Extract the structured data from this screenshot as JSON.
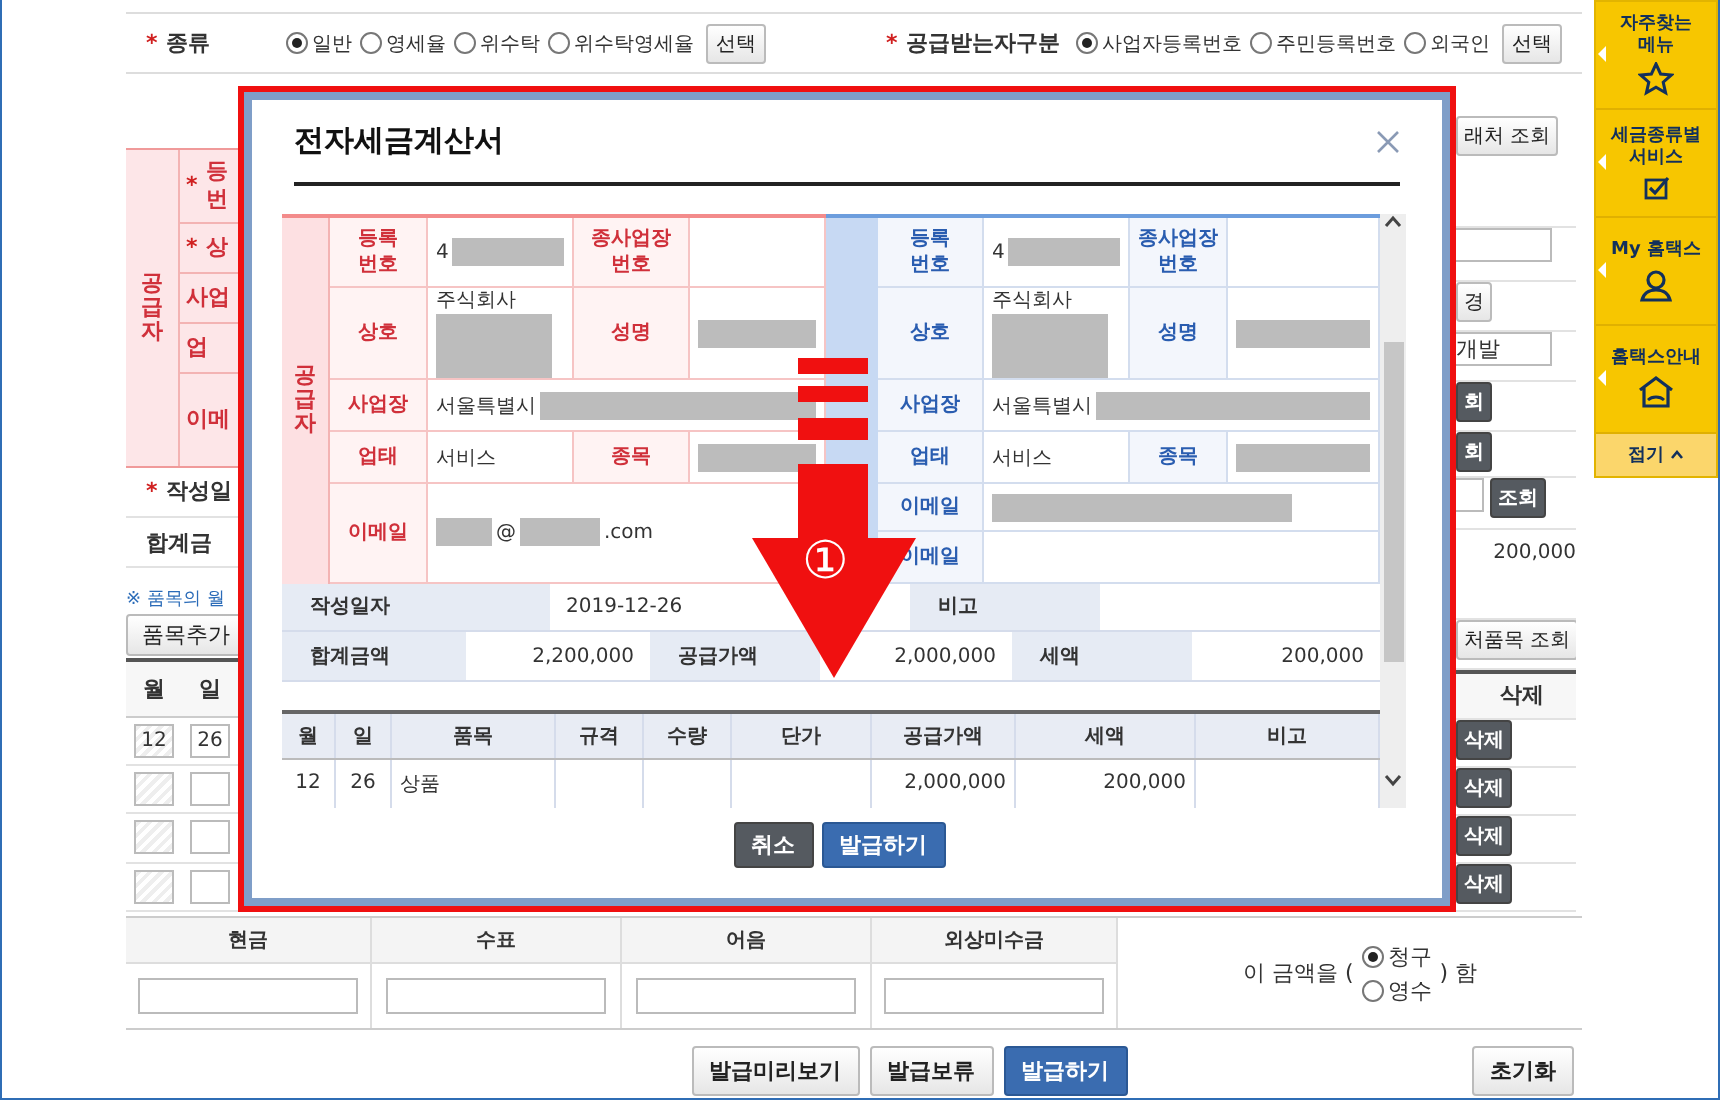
{
  "type_row": [
    {
      "required_mark": "*",
      "label": "종류",
      "options": [
        {
          "label": "일반",
          "selected": true
        },
        {
          "label": "영세율",
          "selected": false
        },
        {
          "label": "위수탁",
          "selected": false
        },
        {
          "label": "위수탁영세율",
          "selected": false
        }
      ],
      "button": "선택"
    },
    {
      "required_mark": "*",
      "label": "공급받는자구분",
      "options": [
        {
          "label": "사업자등록번호",
          "selected": true
        },
        {
          "label": "주민등록번호",
          "selected": false
        },
        {
          "label": "외국인",
          "selected": false
        }
      ],
      "button": "선택"
    }
  ],
  "left_strip": {
    "supplier_label": "공급자",
    "labels": [
      {
        "required_mark": "*",
        "lines": [
          "등",
          "번"
        ]
      },
      {
        "required_mark": "*",
        "lines": [
          "상"
        ]
      },
      {
        "lines": [
          "사업"
        ]
      },
      {
        "lines": [
          "업"
        ]
      },
      {
        "lines": [
          "이메"
        ]
      }
    ],
    "date_label": {
      "required_mark": "*",
      "text": "작성일"
    },
    "total_label": "합계금",
    "note": "※ 품목의 월",
    "add_button": "품목추가",
    "item_headers": [
      "월",
      "일"
    ],
    "item_rows": [
      {
        "kind": "filled",
        "month": "12",
        "day": "26"
      },
      {
        "kind": "empty"
      },
      {
        "kind": "empty"
      },
      {
        "kind": "empty"
      }
    ]
  },
  "dialog": {
    "title": "전자세금계산서",
    "supplier": {
      "group_label": "공급자",
      "rows": [
        {
          "cells": [
            {
              "kind": "label",
              "lines": [
                "등록",
                "번호"
              ]
            },
            {
              "kind": "value",
              "parts": [
                {
                  "kind": "text",
                  "text": "4"
                },
                {
                  "kind": "redacted"
                }
              ]
            },
            {
              "kind": "label",
              "lines": [
                "종사업장",
                "번호"
              ]
            },
            {
              "kind": "value"
            }
          ]
        },
        {
          "cells": [
            {
              "kind": "label",
              "lines": [
                "상호"
              ]
            },
            {
              "kind": "value",
              "parts": [
                {
                  "kind": "text",
                  "text": "주식회사"
                },
                {
                  "kind": "redacted_block"
                }
              ]
            },
            {
              "kind": "label",
              "lines": [
                "성명"
              ]
            },
            {
              "kind": "value",
              "parts": [
                {
                  "kind": "redacted"
                }
              ]
            }
          ]
        },
        {
          "cells": [
            {
              "kind": "label",
              "lines": [
                "사업장"
              ]
            },
            {
              "kind": "wide_value",
              "parts": [
                {
                  "kind": "text",
                  "text": "서울특별시"
                },
                {
                  "kind": "redacted"
                }
              ]
            }
          ]
        },
        {
          "cells": [
            {
              "kind": "label",
              "lines": [
                "업태"
              ]
            },
            {
              "kind": "value",
              "parts": [
                {
                  "kind": "text",
                  "text": "서비스"
                }
              ]
            },
            {
              "kind": "label",
              "lines": [
                "종목"
              ]
            },
            {
              "kind": "value",
              "parts": [
                {
                  "kind": "redacted"
                }
              ]
            }
          ]
        },
        {
          "cells": [
            {
              "kind": "label",
              "lines": [
                "이메일"
              ]
            },
            {
              "kind": "wide_value",
              "parts": [
                {
                  "kind": "redacted"
                },
                {
                  "kind": "text",
                  "text": "@"
                },
                {
                  "kind": "redacted"
                },
                {
                  "kind": "text",
                  "text": ".com"
                }
              ]
            }
          ]
        }
      ]
    },
    "receiver": {
      "rows": [
        {
          "cells": [
            {
              "kind": "label",
              "lines": [
                "등록",
                "번호"
              ]
            },
            {
              "kind": "value",
              "parts": [
                {
                  "kind": "text",
                  "text": "4"
                },
                {
                  "kind": "redacted"
                }
              ]
            },
            {
              "kind": "label",
              "lines": [
                "종사업장",
                "번호"
              ]
            },
            {
              "kind": "value"
            }
          ]
        },
        {
          "cells": [
            {
              "kind": "label",
              "lines": [
                "상호"
              ]
            },
            {
              "kind": "value",
              "parts": [
                {
                  "kind": "text",
                  "text": "주식회사"
                },
                {
                  "kind": "redacted_block"
                }
              ]
            },
            {
              "kind": "label",
              "lines": [
                "성명"
              ]
            },
            {
              "kind": "value",
              "parts": [
                {
                  "kind": "redacted"
                }
              ]
            }
          ]
        },
        {
          "cells": [
            {
              "kind": "label",
              "lines": [
                "사업장"
              ]
            },
            {
              "kind": "wide_value",
              "parts": [
                {
                  "kind": "text",
                  "text": "서울특별시"
                },
                {
                  "kind": "redacted"
                }
              ]
            }
          ]
        },
        {
          "cells": [
            {
              "kind": "label",
              "lines": [
                "업태"
              ]
            },
            {
              "kind": "value",
              "parts": [
                {
                  "kind": "text",
                  "text": "서비스"
                }
              ]
            },
            {
              "kind": "label",
              "lines": [
                "종목"
              ]
            },
            {
              "kind": "value",
              "parts": [
                {
                  "kind": "redacted"
                }
              ]
            }
          ]
        },
        {
          "cells": [
            {
              "kind": "label",
              "lines": [
                "이메일"
              ]
            },
            {
              "kind": "wide_value",
              "parts": [
                {
                  "kind": "redacted"
                }
              ]
            }
          ]
        },
        {
          "cells": [
            {
              "kind": "label",
              "lines": [
                "이메일"
              ]
            },
            {
              "kind": "wide_value"
            }
          ]
        }
      ]
    },
    "summary": [
      [
        {
          "kind": "label",
          "text": "작성일자"
        },
        {
          "kind": "value",
          "text": "2019-12-26"
        },
        {
          "kind": "label",
          "text": "비고"
        },
        {
          "kind": "value"
        }
      ],
      [
        {
          "kind": "label",
          "text": "합계금액"
        },
        {
          "kind": "amount",
          "text": "2,200,000"
        },
        {
          "kind": "label",
          "text": "공급가액"
        },
        {
          "kind": "amount",
          "text": "2,000,000"
        },
        {
          "kind": "label",
          "text": "세액"
        },
        {
          "kind": "amount",
          "text": "200,000"
        }
      ]
    ],
    "item_headers": [
      "월",
      "일",
      "품목",
      "규격",
      "수량",
      "단가",
      "공급가액",
      "세액",
      "비고"
    ],
    "items": [
      {
        "month": "12",
        "day": "26",
        "item": "상품",
        "supply": "2,000,000",
        "tax": "200,000"
      }
    ],
    "buttons": [
      {
        "label": "취소",
        "kind": "dark"
      },
      {
        "label": "발급하기",
        "kind": "primary"
      }
    ]
  },
  "annotation": {
    "step": "①"
  },
  "right_strip": [
    {
      "kind": "button",
      "text": "래처 조회"
    },
    {
      "kind": "field"
    },
    {
      "kind": "button",
      "text": "경"
    },
    {
      "kind": "field",
      "value": "개발"
    },
    {
      "kind": "dark_button",
      "text": "회"
    },
    {
      "kind": "dark_button",
      "text": "회"
    },
    {
      "kind": "field_button",
      "text": "조회"
    },
    {
      "kind": "amount",
      "text": "200,000"
    },
    {
      "kind": "button",
      "text": "처품목 조회"
    },
    {
      "kind": "header",
      "text": "삭제"
    },
    {
      "kind": "dark_button",
      "text": "삭제"
    },
    {
      "kind": "dark_button",
      "text": "삭제"
    },
    {
      "kind": "dark_button",
      "text": "삭제"
    },
    {
      "kind": "dark_button",
      "text": "삭제"
    }
  ],
  "quick_menu": {
    "items": [
      {
        "kind": "star",
        "lines": [
          "자주찾는",
          "메뉴"
        ]
      },
      {
        "kind": "check",
        "lines": [
          "세금종류별",
          "서비스"
        ]
      },
      {
        "kind": "person",
        "lines": [
          "My 홈택스"
        ]
      },
      {
        "kind": "house",
        "lines": [
          "홈택스안내"
        ]
      }
    ],
    "collapse": "접기"
  },
  "payment": {
    "columns": [
      "현금",
      "수표",
      "어음",
      "외상미수금"
    ],
    "statement_prefix": "이 금액을 (",
    "options": [
      {
        "label": "청구",
        "selected": true
      },
      {
        "label": "영수",
        "selected": false
      }
    ],
    "statement_suffix": ") 함"
  },
  "actions": [
    {
      "label": "발급미리보기",
      "kind": "default"
    },
    {
      "label": "발급보류",
      "kind": "default"
    },
    {
      "label": "발급하기",
      "kind": "primary"
    }
  ],
  "reset_button": "초기화"
}
